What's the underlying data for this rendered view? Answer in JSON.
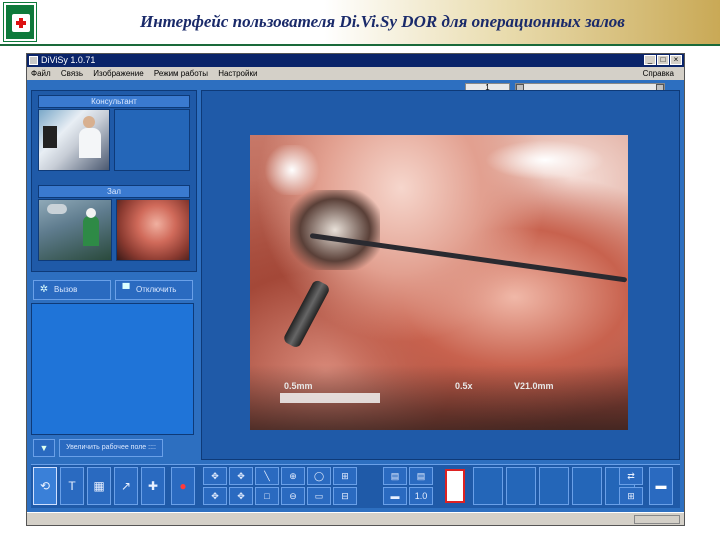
{
  "slide": {
    "title": "Интерфейс пользователя Di.Vi.Sy DOR для операционных залов"
  },
  "window": {
    "title": "DiViSy 1.0.71",
    "controls": [
      "_",
      "□",
      "×"
    ]
  },
  "menu": {
    "items": [
      "Файл",
      "Связь",
      "Изображение",
      "Режим работы",
      "Настройки"
    ],
    "help": "Справка"
  },
  "toolbar": {
    "counter": "1"
  },
  "left_panel": {
    "consultant_label": "Консультант",
    "room_label": "Зал",
    "call_button": "Вызов",
    "second_button": "Отключить",
    "incr_button": "Увеличить рабочее поле ::::"
  },
  "video": {
    "overlay_left": "0.5mm",
    "overlay_mid": "0.5x",
    "overlay_right": "V21.0mm"
  },
  "bottom_toolbar": {
    "main_tools": [
      "⟲",
      "T",
      "▦",
      "↗",
      "✚"
    ],
    "record_icon": "●",
    "nav_grid": [
      "✥",
      "✥",
      "╲",
      "⊕",
      "◯",
      "⊞",
      "✥",
      "✥",
      "□",
      "⊖",
      "▭",
      "⊟"
    ],
    "color_grid": [
      "▤",
      "▤",
      "▬",
      "1.0"
    ],
    "right_grid": [
      "⇄",
      "⊞"
    ],
    "flag": "▬"
  }
}
